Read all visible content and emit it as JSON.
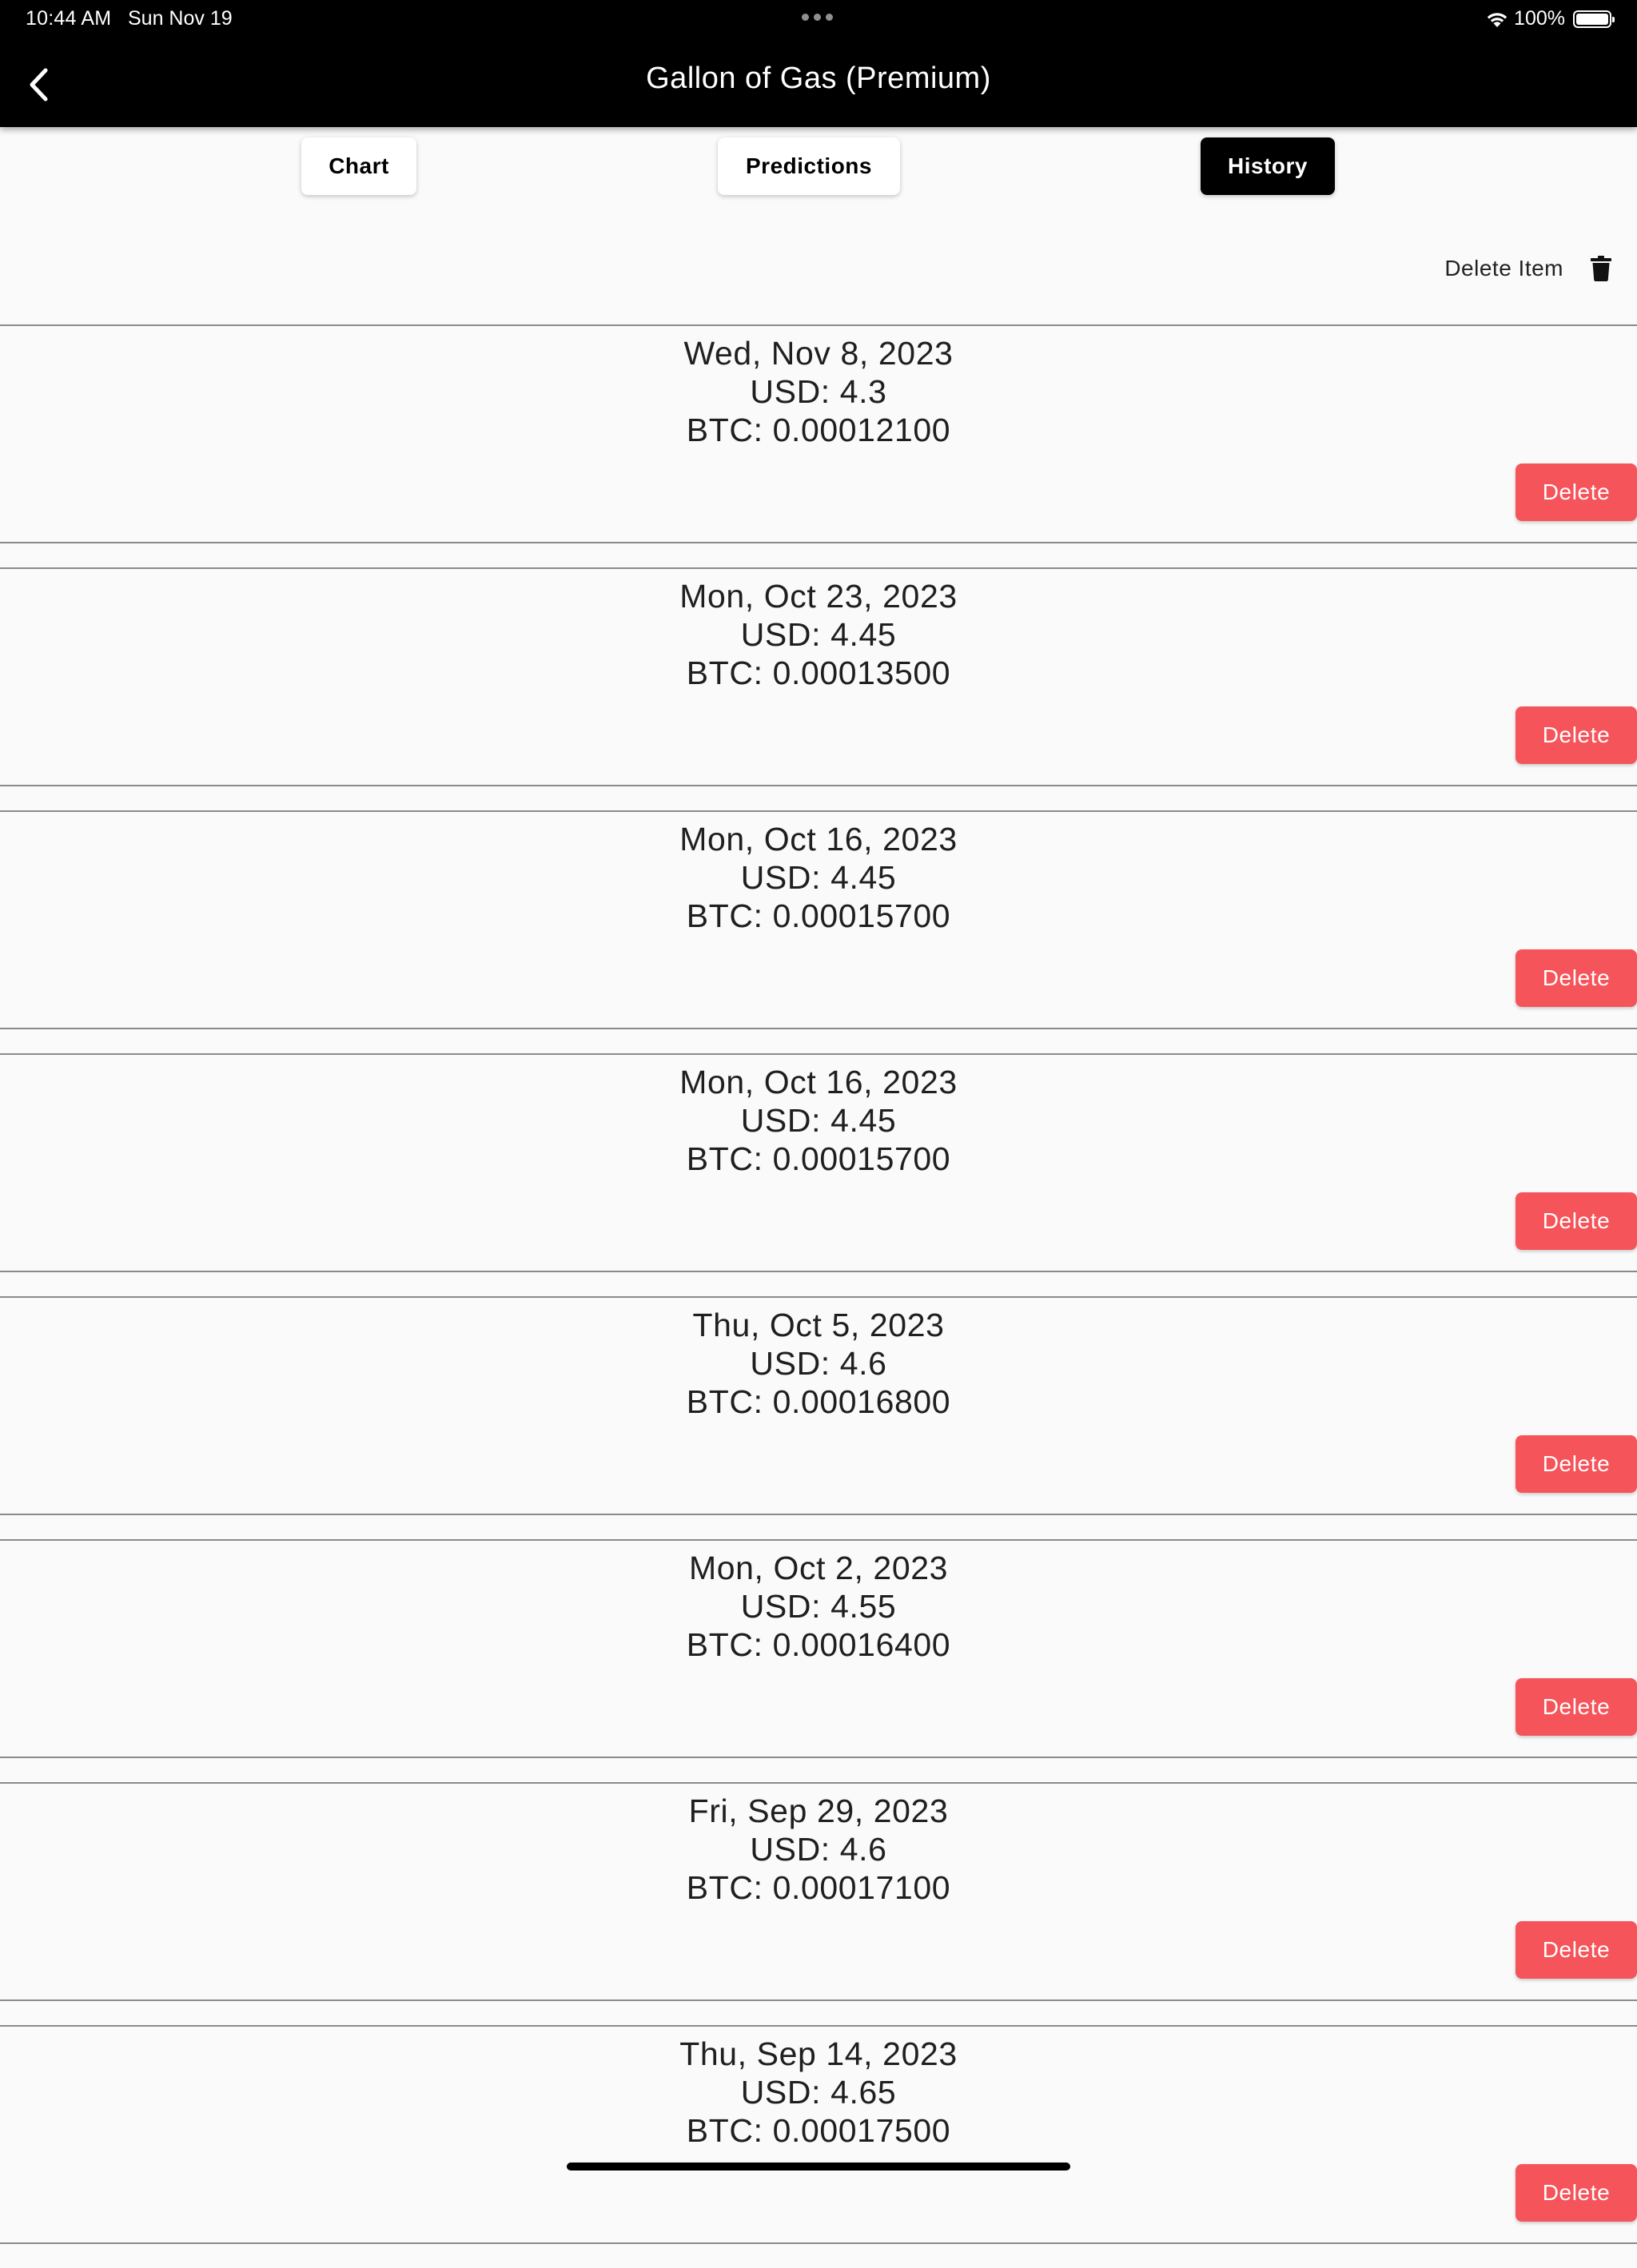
{
  "status_bar": {
    "time": "10:44 AM",
    "date": "Sun Nov 19",
    "battery": "100%"
  },
  "nav": {
    "title": "Gallon of Gas (Premium)"
  },
  "tabs": [
    {
      "label": "Chart"
    },
    {
      "label": "Predictions"
    },
    {
      "label": "History"
    }
  ],
  "active_tab": "History",
  "toolbar": {
    "delete_item_label": "Delete Item"
  },
  "history": {
    "delete_label": "Delete",
    "entries": [
      {
        "date": "Wed, Nov 8, 2023",
        "usd": "USD: 4.3",
        "btc": "BTC: 0.00012100"
      },
      {
        "date": "Mon, Oct 23, 2023",
        "usd": "USD: 4.45",
        "btc": "BTC: 0.00013500"
      },
      {
        "date": "Mon, Oct 16, 2023",
        "usd": "USD: 4.45",
        "btc": "BTC: 0.00015700"
      },
      {
        "date": "Mon, Oct 16, 2023",
        "usd": "USD: 4.45",
        "btc": "BTC: 0.00015700"
      },
      {
        "date": "Thu, Oct 5, 2023",
        "usd": "USD: 4.6",
        "btc": "BTC: 0.00016800"
      },
      {
        "date": "Mon, Oct 2, 2023",
        "usd": "USD: 4.55",
        "btc": "BTC: 0.00016400"
      },
      {
        "date": "Fri, Sep 29, 2023",
        "usd": "USD: 4.6",
        "btc": "BTC: 0.00017100"
      },
      {
        "date": "Thu, Sep 14, 2023",
        "usd": "USD: 4.65",
        "btc": "BTC: 0.00017500"
      }
    ]
  },
  "colors": {
    "delete_button": "#f5545a",
    "header_bg": "#000000",
    "active_tab_bg": "#000000",
    "page_bg": "#fafafa"
  },
  "icons": {
    "back": "chevron-left-icon",
    "delete_item": "trash-icon",
    "wifi": "wifi-icon",
    "battery": "battery-icon"
  }
}
